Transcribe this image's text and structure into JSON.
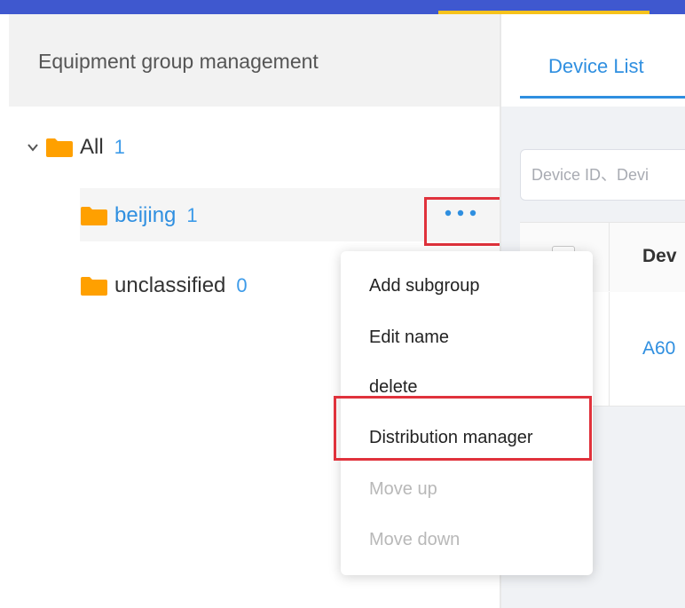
{
  "colors": {
    "topbar": "#3f58cf",
    "topbar_accent": "#f6c21c",
    "link_blue": "#2f8fe0",
    "count_blue": "#3d9be9",
    "folder_orange": "#ffa000",
    "highlight_red": "#e0323c"
  },
  "left_panel": {
    "title": "Equipment group management",
    "tree": [
      {
        "label": "All",
        "count": "1",
        "icon": "folder-icon",
        "expanded": true
      },
      {
        "label": "beijing",
        "count": "1",
        "icon": "folder-icon",
        "selected": true
      },
      {
        "label": "unclassified",
        "count": "0",
        "icon": "folder-icon"
      }
    ],
    "more_icon": "more-dots-icon"
  },
  "context_menu": {
    "items": [
      {
        "label": "Add subgroup",
        "enabled": true
      },
      {
        "label": "Edit name",
        "enabled": true
      },
      {
        "label": "delete",
        "enabled": true
      },
      {
        "label": "Distribution manager",
        "enabled": true
      },
      {
        "label": "Move up",
        "enabled": false
      },
      {
        "label": "Move down",
        "enabled": false
      }
    ]
  },
  "right_panel": {
    "tab_label": "Device List",
    "search_placeholder": "Device ID、Devi",
    "table_header_col": "Dev",
    "table_rows": [
      {
        "device": "A60"
      }
    ]
  }
}
